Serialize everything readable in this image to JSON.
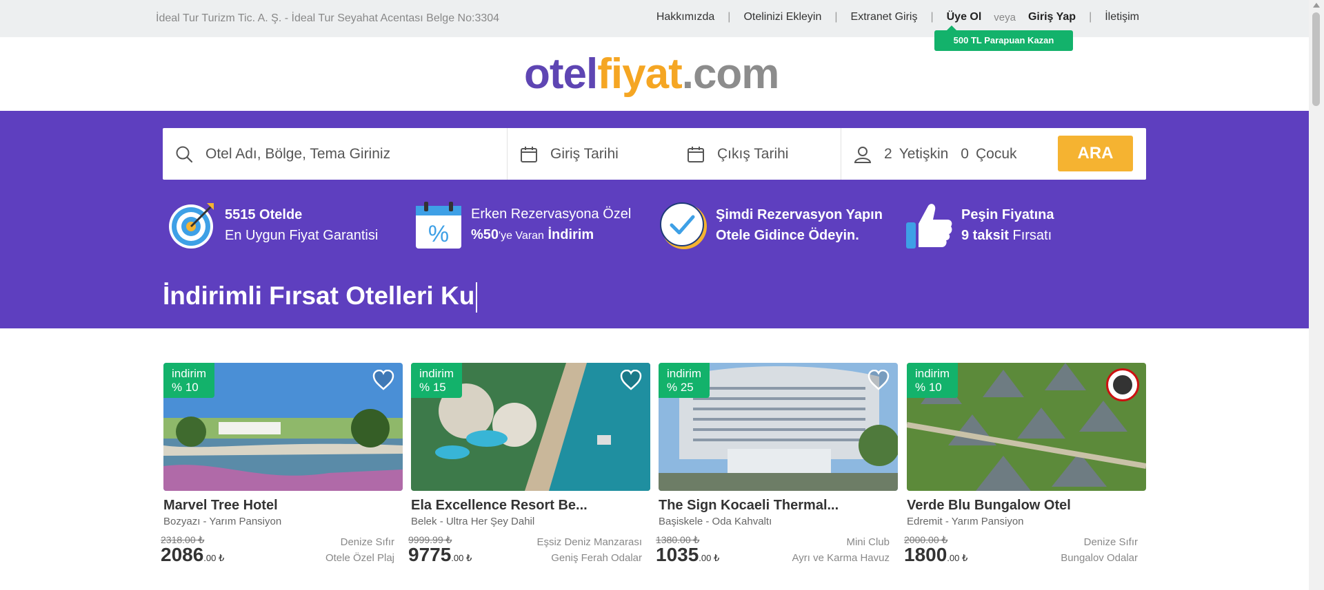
{
  "topbar": {
    "company": "İdeal Tur Turizm Tic. A. Ş. - İdeal Tur Seyahat Acentası Belge No:3304",
    "nav": {
      "about": "Hakkımızda",
      "add_hotel": "Otelinizi Ekleyin",
      "extranet": "Extranet Giriş",
      "register": "Üye Ol",
      "or": "veya",
      "login": "Giriş Yap",
      "contact": "İletişim"
    },
    "bonus": "500 TL Parapuan Kazan"
  },
  "logo": {
    "part1": "otel",
    "part2": "fiyat",
    "part3": ".com",
    "colors": {
      "otel": "#5e45b3",
      "fiyat": "#f5a623",
      "com": "#8c8c8c"
    }
  },
  "search": {
    "query_placeholder": "Otel Adı, Bölge, Tema Giriniz",
    "checkin": "Giriş Tarihi",
    "checkout": "Çıkış Tarihi",
    "adults": "2",
    "adults_label": "Yetişkin",
    "children": "0",
    "children_label": "Çocuk",
    "button": "ARA"
  },
  "features": [
    {
      "icon": "target-icon",
      "line1": "5515 Otelde",
      "line2": "En Uygun Fiyat Garantisi"
    },
    {
      "icon": "calendar-percent-icon",
      "line1": "Erken Rezervasyona Özel",
      "line2a": "%50",
      "line2b": "'ye Varan",
      "line2c": "İndirim"
    },
    {
      "icon": "checkmark-circle-icon",
      "line1": "Şimdi Rezervasyon Yapın",
      "line2": "Otele Gidince Ödeyin."
    },
    {
      "icon": "thumbs-up-icon",
      "line1": "Peşin Fiyatına",
      "line2a": "9 taksit",
      "line2b": "Fırsatı"
    }
  ],
  "headline": "İndirimli Fırsat Otelleri Ku",
  "colors": {
    "brand_purple": "#5e3fbf",
    "accent_yellow": "#f5b331",
    "green": "#13b26b"
  },
  "hotels": [
    {
      "badge_label": "indirim",
      "discount": "% 10",
      "name": "Marvel Tree Hotel",
      "location": "Bozyazı - Yarım Pansiyon",
      "old_price": "2318.00 ₺",
      "price_main": "2086",
      "price_dec": ".00 ₺",
      "tag1": "Denize Sıfır",
      "tag2": "Otele Özel Plaj"
    },
    {
      "badge_label": "indirim",
      "discount": "% 15",
      "name": "Ela Excellence Resort Be...",
      "location": "Belek - Ultra Her Şey Dahil",
      "old_price": "9999.99 ₺",
      "price_main": "9775",
      "price_dec": ".00 ₺",
      "tag1": "Eşsiz Deniz Manzarası",
      "tag2": "Geniş Ferah Odalar"
    },
    {
      "badge_label": "indirim",
      "discount": "% 25",
      "name": "The Sign Kocaeli Thermal...",
      "location": "Başiskele - Oda Kahvaltı",
      "old_price": "1380.00 ₺",
      "price_main": "1035",
      "price_dec": ".00 ₺",
      "tag1": "Mini Club",
      "tag2": "Ayrı ve Karma Havuz"
    },
    {
      "badge_label": "indirim",
      "discount": "% 10",
      "name": "Verde Blu Bungalow Otel",
      "location": "Edremit - Yarım Pansiyon",
      "old_price": "2000.00 ₺",
      "price_main": "1800",
      "price_dec": ".00 ₺",
      "tag1": "Denize Sıfır",
      "tag2": "Bungalov Odalar"
    }
  ]
}
